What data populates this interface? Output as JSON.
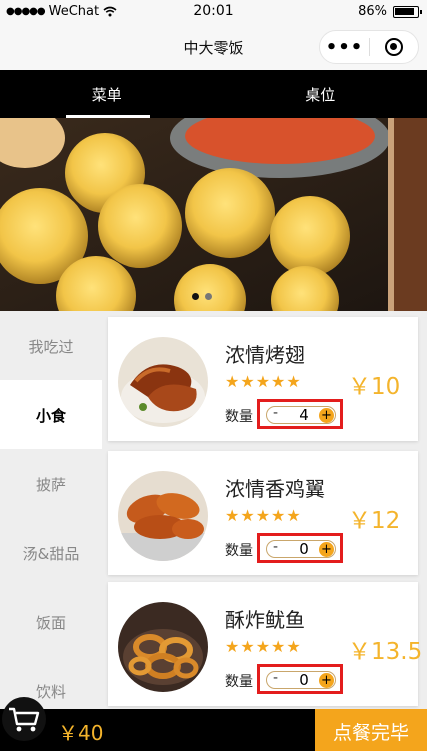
{
  "status_bar": {
    "carrier": "WeChat",
    "time": "20:01",
    "battery": "86%"
  },
  "navbar": {
    "title": "中大零饭"
  },
  "tabs": [
    {
      "label": "菜单",
      "active": true
    },
    {
      "label": "桌位",
      "active": false
    }
  ],
  "banner": {
    "pages": 2,
    "active_page": 1
  },
  "sidebar": {
    "items": [
      {
        "label": "我吃过"
      },
      {
        "label": "小食"
      },
      {
        "label": "披萨"
      },
      {
        "label": "汤&甜品"
      },
      {
        "label": "饭面"
      },
      {
        "label": "饮料"
      }
    ],
    "active_index": 1
  },
  "dishes": [
    {
      "name": "浓情烤翅",
      "rating": 5,
      "stars": "★★★★★",
      "price": "￥10",
      "qty_label": "数量",
      "minus": "-",
      "quantity": "4",
      "plus": "+"
    },
    {
      "name": "浓情香鸡翼",
      "rating": 5,
      "stars": "★★★★★",
      "price": "￥12",
      "qty_label": "数量",
      "minus": "-",
      "quantity": "0",
      "plus": "+"
    },
    {
      "name": "酥炸鱿鱼",
      "rating": 5,
      "stars": "★★★★★",
      "price": "￥13.5",
      "qty_label": "数量",
      "minus": "-",
      "quantity": "0",
      "plus": "+"
    }
  ],
  "cart": {
    "total": "￥40",
    "checkout_label": "点餐完毕"
  },
  "colors": {
    "accent": "#f4a51c",
    "highlight_border": "#e31d1d",
    "tab_bar": "#000000"
  }
}
